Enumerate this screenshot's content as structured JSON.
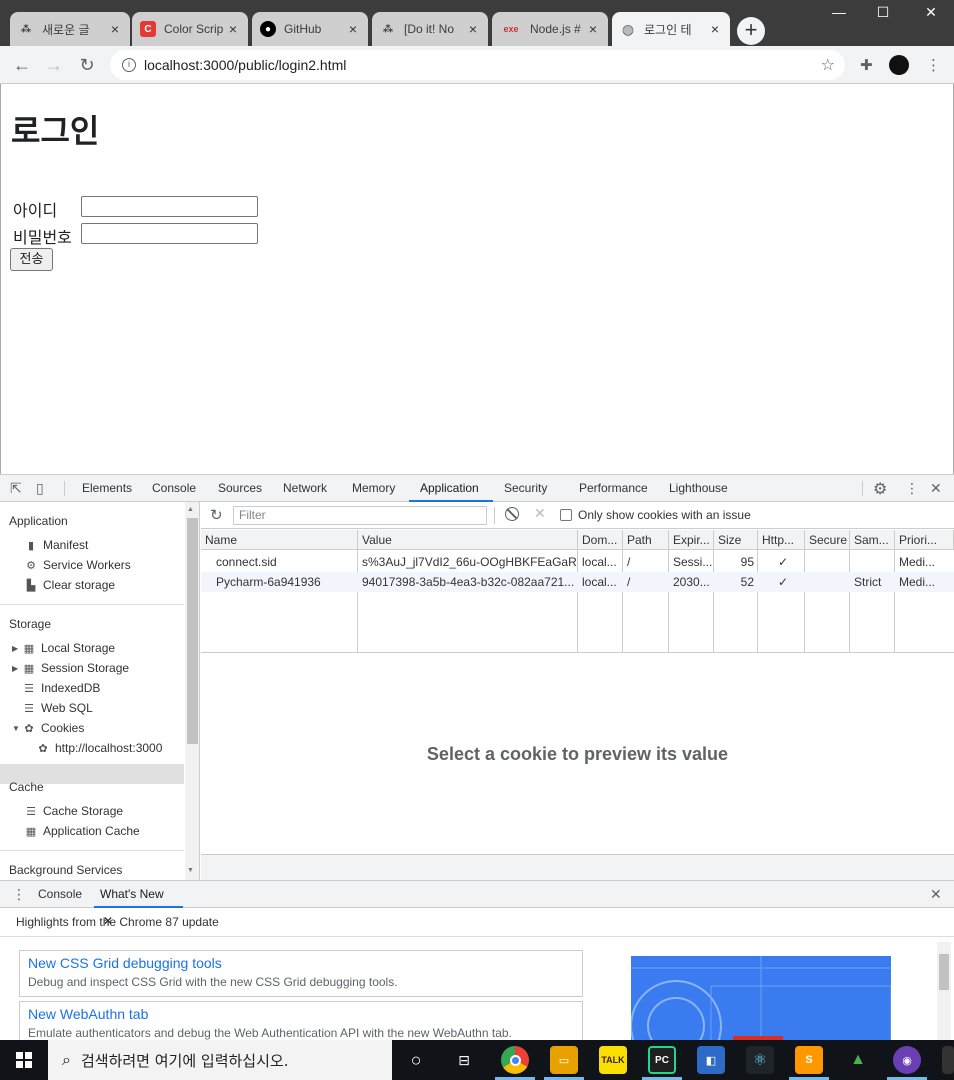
{
  "browser": {
    "tabs": [
      {
        "title": "새로운 글",
        "favicon": "T",
        "favicon_color": "#3c3c3c",
        "active": false
      },
      {
        "title": "Color Scrip",
        "favicon": "C",
        "favicon_color": "#e53935",
        "active": false
      },
      {
        "title": "GitHub",
        "favicon": "github-icon",
        "favicon_color": "#000000",
        "active": false
      },
      {
        "title": "[Do it! No",
        "favicon": "T",
        "favicon_color": "#3c3c3c",
        "active": false
      },
      {
        "title": "Node.js #",
        "favicon": "exe",
        "favicon_color": "#d32f2f",
        "active": false
      },
      {
        "title": "로그인 테",
        "favicon": "globe-icon",
        "favicon_color": "#5f6368",
        "active": true
      }
    ],
    "url": "localhost:3000/public/login2.html"
  },
  "page": {
    "heading": "로그인",
    "id_label": "아이디",
    "password_label": "비밀번호",
    "submit_label": "전송"
  },
  "devtools": {
    "tabs": [
      "Elements",
      "Console",
      "Sources",
      "Network",
      "Memory",
      "Application",
      "Security",
      "Performance",
      "Lighthouse"
    ],
    "active_tab": "Application",
    "sidebar": {
      "application_header": "Application",
      "application_items": [
        "Manifest",
        "Service Workers",
        "Clear storage"
      ],
      "storage_header": "Storage",
      "storage_items": [
        "Local Storage",
        "Session Storage",
        "IndexedDB",
        "Web SQL",
        "Cookies"
      ],
      "cookie_origin": "http://localhost:3000",
      "cache_header": "Cache",
      "cache_items": [
        "Cache Storage",
        "Application Cache"
      ],
      "background_header": "Background Services"
    },
    "cookies": {
      "filter_placeholder": "Filter",
      "only_issue_label": "Only show cookies with an issue",
      "columns": [
        "Name",
        "Value",
        "Dom...",
        "Path",
        "Expir...",
        "Size",
        "Http...",
        "Secure",
        "Sam...",
        "Priori..."
      ],
      "rows": [
        [
          "connect.sid",
          "s%3AuJ_jl7VdI2_66u-OOgHBKFEaGaR...",
          "local...",
          "/",
          "Sessi...",
          "95",
          "✓",
          "",
          "",
          "Medi..."
        ],
        [
          "Pycharm-6a941936",
          "94017398-3a5b-4ea3-b32c-082aa721...",
          "local...",
          "/",
          "2030...",
          "52",
          "✓",
          "",
          "Strict",
          "Medi..."
        ]
      ],
      "preview_message": "Select a cookie to preview its value"
    },
    "drawer": {
      "tabs": [
        "Console",
        "What's New"
      ],
      "active_tab": "What's New",
      "highlights": "Highlights from the Chrome 87 update",
      "cards": [
        {
          "title": "New CSS Grid debugging tools",
          "desc": "Debug and inspect CSS Grid with the new CSS Grid debugging tools."
        },
        {
          "title": "New WebAuthn tab",
          "desc": "Emulate authenticators and debug the Web Authentication API with the new WebAuthn tab."
        }
      ]
    }
  },
  "taskbar": {
    "search_placeholder": "검색하려면 여기에 입력하십시오."
  }
}
